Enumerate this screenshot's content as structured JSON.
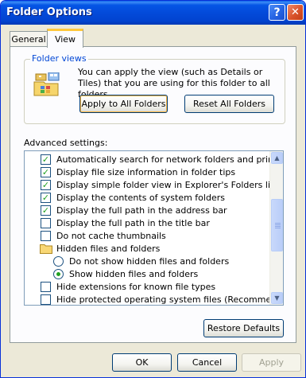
{
  "window": {
    "title": "Folder Options"
  },
  "caption_buttons": {
    "help": "?",
    "close": "✕"
  },
  "tabs": [
    {
      "label": "General",
      "selected": false
    },
    {
      "label": "View",
      "selected": true
    }
  ],
  "folder_views": {
    "group_label": "Folder views",
    "description": "You can apply the view (such as Details or Tiles) that you are using for this folder to all folders.",
    "apply_button": "Apply to All Folders",
    "reset_button": "Reset All Folders"
  },
  "advanced": {
    "label": "Advanced settings:",
    "items": [
      {
        "type": "checkbox",
        "checked": true,
        "label": "Automatically search for network folders and printers"
      },
      {
        "type": "checkbox",
        "checked": true,
        "label": "Display file size information in folder tips"
      },
      {
        "type": "checkbox",
        "checked": true,
        "label": "Display simple folder view in Explorer's Folders list"
      },
      {
        "type": "checkbox",
        "checked": true,
        "label": "Display the contents of system folders"
      },
      {
        "type": "checkbox",
        "checked": true,
        "label": "Display the full path in the address bar"
      },
      {
        "type": "checkbox",
        "checked": false,
        "label": "Display the full path in the title bar"
      },
      {
        "type": "checkbox",
        "checked": false,
        "label": "Do not cache thumbnails"
      },
      {
        "type": "folder",
        "label": "Hidden files and folders"
      },
      {
        "type": "radio",
        "checked": false,
        "label": "Do not show hidden files and folders"
      },
      {
        "type": "radio",
        "checked": true,
        "label": "Show hidden files and folders"
      },
      {
        "type": "checkbox",
        "checked": false,
        "label": "Hide extensions for known file types"
      },
      {
        "type": "checkbox",
        "checked": false,
        "label": "Hide protected operating system files (Recommended)"
      }
    ],
    "scroll_up": "▲",
    "scroll_down": "▼",
    "restore_button": "Restore Defaults"
  },
  "footer": {
    "ok": "OK",
    "cancel": "Cancel",
    "apply": "Apply",
    "apply_enabled": false
  },
  "colors": {
    "titlebar": "#0349d8",
    "group_label": "#0046d5",
    "check": "#21a121",
    "tab_highlight": "#ffc83c"
  }
}
